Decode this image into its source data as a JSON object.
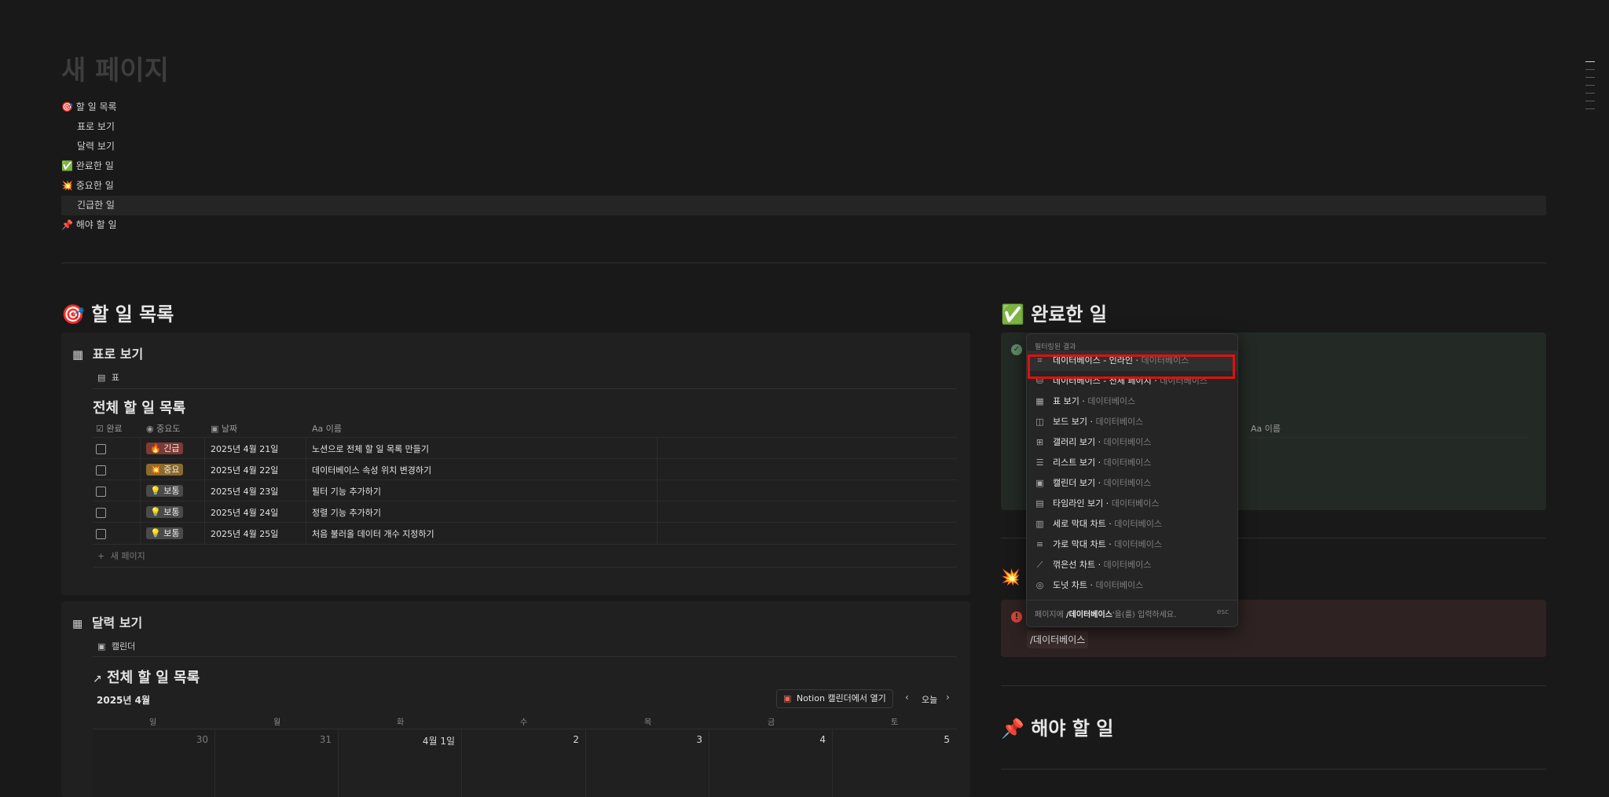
{
  "page": {
    "title": "새 페이지"
  },
  "toc": [
    {
      "label": "🎯 할 일 목록",
      "sub": false
    },
    {
      "label": "표로 보기",
      "sub": true
    },
    {
      "label": "달력 보기",
      "sub": true
    },
    {
      "label": "✅ 완료한 일",
      "sub": false
    },
    {
      "label": "💥 중요한 일",
      "sub": false
    },
    {
      "label": "긴급한 일",
      "sub": true
    },
    {
      "label": "📌 해야 할 일",
      "sub": false
    }
  ],
  "todo": {
    "heading_icon": "🎯",
    "heading": "할 일 목록",
    "table_view": {
      "title": "표로 보기",
      "tab": "표",
      "db_title": "전체 할 일 목록",
      "columns": {
        "done": "완료",
        "priority": "중요도",
        "date": "날짜",
        "name": "이름",
        "name_prefix": "Aa"
      },
      "rows": [
        {
          "tag": "🔥 긴급",
          "tag_color": "#7d3b35",
          "date": "2025년 4월 21일",
          "name": "노션으로 전체 할 일 목록 만들기"
        },
        {
          "tag": "💥 중요",
          "tag_color": "#8a6a2e",
          "date": "2025년 4월 22일",
          "name": "데이터베이스 속성 위치 변경하기"
        },
        {
          "tag": "💡 보통",
          "tag_color": "#4a4a4a",
          "date": "2025년 4월 23일",
          "name": "필터 기능 추가하기"
        },
        {
          "tag": "💡 보통",
          "tag_color": "#4a4a4a",
          "date": "2025년 4월 24일",
          "name": "정렬 기능 추가하기"
        },
        {
          "tag": "💡 보통",
          "tag_color": "#4a4a4a",
          "date": "2025년 4월 25일",
          "name": "처음 불러올 데이터 개수 지정하기"
        }
      ],
      "new_page": "새 페이지"
    },
    "calendar_view": {
      "title": "달력 보기",
      "tab": "캘린더",
      "db_title": "전체 할 일 목록",
      "month": "2025년 4월",
      "open_button": "Notion 캘린더에서 열기",
      "today": "오늘",
      "weekdays": [
        "일",
        "월",
        "화",
        "수",
        "목",
        "금",
        "토"
      ],
      "days": [
        "30",
        "31",
        "4월 1일",
        "2",
        "3",
        "4",
        "5"
      ]
    }
  },
  "done": {
    "heading_icon": "✅",
    "heading": "완료한 일",
    "column_name": "이름",
    "column_prefix": "Aa"
  },
  "important": {
    "heading_icon": "💥",
    "input_text": "/데이터베이스"
  },
  "must": {
    "heading_icon": "📌",
    "heading": "해야 할 일"
  },
  "menu": {
    "header": "필터링된 결과",
    "items": [
      {
        "icon": "⌗",
        "label": "데이터베이스 - 인라인",
        "sub": "데이터베이스"
      },
      {
        "icon": "⛁",
        "label": "데이터베이스 - 전체 페이지",
        "sub": "데이터베이스"
      },
      {
        "icon": "▦",
        "label": "표 보기",
        "sub": "데이터베이스"
      },
      {
        "icon": "◫",
        "label": "보드 보기",
        "sub": "데이터베이스"
      },
      {
        "icon": "⊞",
        "label": "갤러리 보기",
        "sub": "데이터베이스"
      },
      {
        "icon": "☰",
        "label": "리스트 보기",
        "sub": "데이터베이스"
      },
      {
        "icon": "▣",
        "label": "캘린더 보기",
        "sub": "데이터베이스"
      },
      {
        "icon": "▤",
        "label": "타임라인 보기",
        "sub": "데이터베이스"
      },
      {
        "icon": "▥",
        "label": "세로 막대 차트",
        "sub": "데이터베이스"
      },
      {
        "icon": "≡",
        "label": "가로 막대 차트",
        "sub": "데이터베이스"
      },
      {
        "icon": "⟋",
        "label": "꺾은선 차트",
        "sub": "데이터베이스"
      },
      {
        "icon": "◎",
        "label": "도넛 차트",
        "sub": "데이터베이스"
      }
    ],
    "footer_prefix": "페이지에",
    "footer_bold": "/데이터베이스",
    "footer_suffix": "'을(를) 입력하세요.",
    "footer_esc": "esc"
  },
  "colors": {
    "background": "#191919",
    "panel": "#202020",
    "highlight": "#e01010",
    "done_panel": "#232924",
    "error_panel": "#2e2322"
  }
}
